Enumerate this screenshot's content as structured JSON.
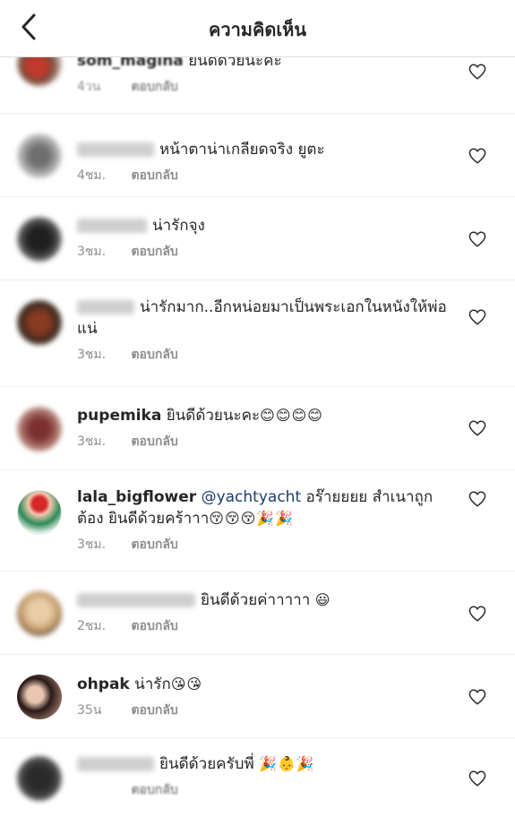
{
  "header": {
    "title": "ความคิดเห็น",
    "back_icon": "chevron-left-icon"
  },
  "colors": {
    "text": "#262626",
    "secondary": "#8e8e8e",
    "mention": "#1c3d6e",
    "divider": "#efefef"
  },
  "comments": [
    {
      "username": "som_magina",
      "text": "ยินดีด้วยนะคะ",
      "time": "4วน",
      "reply": "ตอบกลับ",
      "blurred": true
    },
    {
      "username": "",
      "text": "หน้าตาน่าเกลียดจริง ยูตะ",
      "time": "4ชม.",
      "reply": "ตอบกลับ",
      "blurred": true
    },
    {
      "username": "",
      "text": "น่ารักจุง",
      "time": "3ชม.",
      "reply": "ตอบกลับ",
      "blurred": true
    },
    {
      "username": "",
      "text": "น่ารักมาก..อีกหน่อยมาเป็นพระเอกในหนังให้พ่อแน่",
      "time": "3ชม.",
      "reply": "ตอบกลับ",
      "blurred": true
    },
    {
      "username": "pupemika",
      "text": "ยินดีด้วยนะคะ",
      "emoji": "😊😊😊😊",
      "time": "3ชม.",
      "reply": "ตอบกลับ",
      "blurred": false
    },
    {
      "username": "lala_bigflower",
      "mention": "@yachtyacht",
      "text": "อร๊ายยยย สำเนาถูกต้อง ยินดีด้วยคร้าาา",
      "emoji": "😚😚😚🎉🎉",
      "time": "3ชม.",
      "reply": "ตอบกลับ",
      "blurred": false
    },
    {
      "username": "",
      "text": "ยินดีด้วยค่าาาาา",
      "emoji": "😃",
      "time": "2ชม.",
      "reply": "ตอบกลับ",
      "blurred": true
    },
    {
      "username": "ohpak",
      "text": "น่ารัก",
      "emoji": "😘😘",
      "time": "35น",
      "reply": "ตอบกลับ",
      "blurred": false
    },
    {
      "username": "",
      "text": "ยินดีด้วยครับพี่",
      "emoji": "🎉👶🎉",
      "time": "",
      "reply": "ตอบกลับ",
      "blurred": true
    }
  ]
}
